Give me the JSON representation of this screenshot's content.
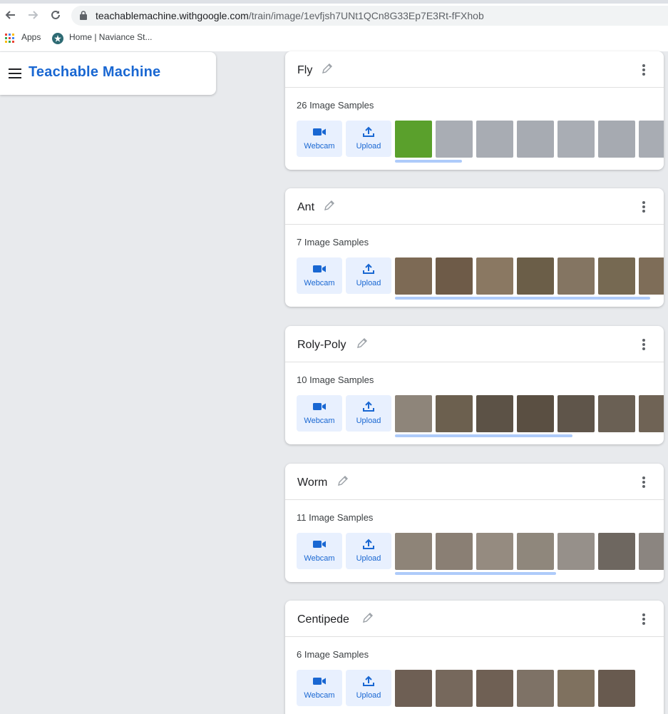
{
  "browser": {
    "url_host": "teachablemachine.withgoogle.com",
    "url_path": "/train/image/1evfjsh7UNt1QCn8G33Ep7E3Rt-fFXhob",
    "bookmarks": [
      {
        "label": "Apps",
        "icon": "apps-grid-icon"
      },
      {
        "label": "Home | Naviance St...",
        "icon": "naviance-icon"
      }
    ]
  },
  "app": {
    "title": "Teachable Machine"
  },
  "buttons": {
    "webcam_label": "Webcam",
    "upload_label": "Upload"
  },
  "colors": {
    "accent": "#1967d2",
    "button_bg": "#e8f0fe",
    "scrollbar": "#aecbfa"
  },
  "classes": [
    {
      "name": "Fly",
      "samples": "26 Image Samples",
      "thumb_colors": [
        "#5aa02c",
        "#a9adb4",
        "#a8acb3",
        "#a7abb2",
        "#a9adb4",
        "#a6aab1",
        "#a8acb3"
      ],
      "scroll_fraction": 0.25
    },
    {
      "name": "Ant",
      "samples": "7 Image Samples",
      "thumb_colors": [
        "#7d6a55",
        "#6e5b48",
        "#8a7862",
        "#6b5e48",
        "#847562",
        "#766952",
        "#7e6d58"
      ],
      "scroll_fraction": 0.95
    },
    {
      "name": "Roly-Poly",
      "samples": "10 Image Samples",
      "thumb_colors": [
        "#8e857a",
        "#6c604f",
        "#5c5246",
        "#5a4f42",
        "#5f554a",
        "#6a6054",
        "#6f6355"
      ],
      "scroll_fraction": 0.66
    },
    {
      "name": "Worm",
      "samples": "11 Image Samples",
      "thumb_colors": [
        "#8e8478",
        "#8a7f74",
        "#958b80",
        "#8f877c",
        "#96908a",
        "#6e6760",
        "#8b8580"
      ],
      "scroll_fraction": 0.6
    },
    {
      "name": "Centipede",
      "samples": "6 Image Samples",
      "thumb_colors": [
        "#6e5f54",
        "#76685c",
        "#6f6054",
        "#7e7266",
        "#7f715f",
        "#685a4f"
      ],
      "scroll_fraction": 0
    }
  ]
}
